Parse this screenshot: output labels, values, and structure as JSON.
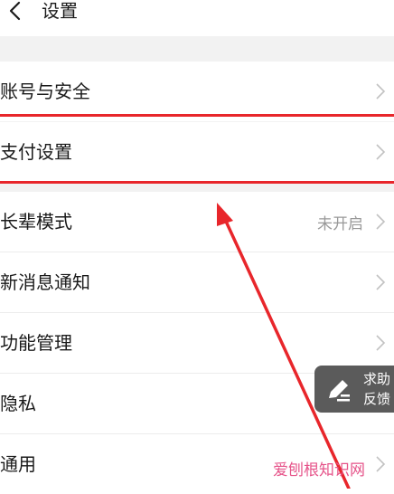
{
  "header": {
    "title": "设置"
  },
  "rows": [
    {
      "label": "账号与安全",
      "value": ""
    },
    {
      "label": "支付设置",
      "value": ""
    },
    {
      "label": "长辈模式",
      "value": "未开启"
    },
    {
      "label": "新消息通知",
      "value": ""
    },
    {
      "label": "功能管理",
      "value": ""
    },
    {
      "label": "隐私",
      "value": ""
    },
    {
      "label": "通用",
      "value": ""
    }
  ],
  "feedback": {
    "line1": "求助",
    "line2": "反馈"
  },
  "watermark": "爱刨根知识网",
  "colors": {
    "highlight": "#e8262b",
    "background": "#f2f2f2",
    "feedback_bg": "#5b5b5b",
    "watermark": "#e6548a"
  }
}
